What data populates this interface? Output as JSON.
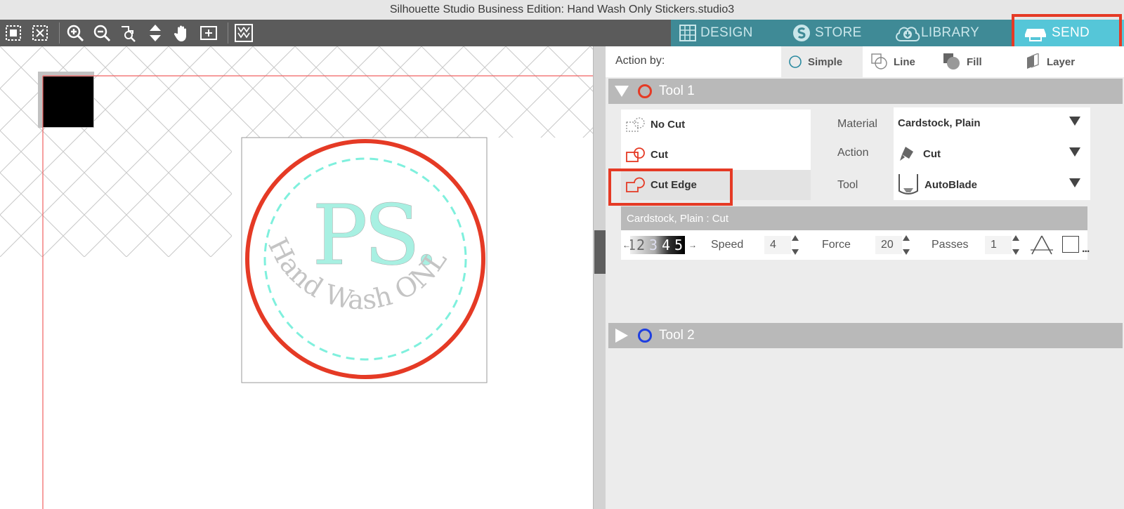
{
  "window": {
    "title": "Silhouette Studio Business Edition: Hand Wash Only Stickers.studio3"
  },
  "toolbar": {
    "icons": [
      "select-all-icon",
      "deselect-icon",
      "zoom-in-icon",
      "zoom-out-icon",
      "zoom-selection-icon",
      "move-drag-icon",
      "pan-hand-icon",
      "fit-to-page-icon",
      "page-layout-icon"
    ]
  },
  "nav": {
    "design": "DESIGN",
    "store": "STORE",
    "library": "LIBRARY",
    "send": "SEND",
    "active": "SEND",
    "active_color": "#55c6d8",
    "bar_color": "#3f8a96"
  },
  "panel": {
    "action_by_label": "Action by:",
    "modes": [
      "Simple",
      "Line",
      "Fill",
      "Layer"
    ],
    "selected_mode": "Simple",
    "tool1": {
      "name": "Tool 1",
      "color": "#e53a25",
      "expanded": true
    },
    "tool2": {
      "name": "Tool 2",
      "color": "#1f3fe0",
      "expanded": false
    },
    "cut_options": [
      "No Cut",
      "Cut",
      "Cut Edge"
    ],
    "selected_cut_option": "Cut Edge",
    "material_label": "Material",
    "material_value": "Cardstock, Plain",
    "action_label": "Action",
    "action_value": "Cut",
    "tool_label": "Tool",
    "tool_value": "AutoBlade",
    "material_summary": "Cardstock, Plain : Cut",
    "blade_steps": [
      "1",
      "2",
      "3",
      "4",
      "5"
    ],
    "speed_label": "Speed",
    "speed_value": "4",
    "force_label": "Force",
    "force_value": "20",
    "passes_label": "Passes",
    "passes_value": "1",
    "more": "..."
  },
  "design": {
    "big_text": "PS.",
    "arc_text": "Hand Wash ONLY",
    "cut_line_color": "#e53a25",
    "accent_color": "#a8f0e2",
    "arc_text_color": "#c4c4c4"
  },
  "highlight_color": "#e53a25"
}
